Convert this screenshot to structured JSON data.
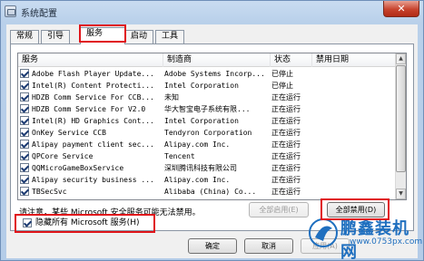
{
  "window": {
    "title": "系统配置",
    "close_glyph": "✕"
  },
  "tabs": [
    {
      "label": "常规"
    },
    {
      "label": "引导"
    },
    {
      "label": "服务"
    },
    {
      "label": "启动"
    },
    {
      "label": "工具"
    }
  ],
  "services": {
    "columns": [
      "服务",
      "制造商",
      "状态",
      "禁用日期"
    ],
    "rows": [
      {
        "name": "Adobe Flash Player Update...",
        "manufacturer": "Adobe Systems Incorp...",
        "status": "已停止",
        "checked": true
      },
      {
        "name": "Intel(R) Content Protecti...",
        "manufacturer": "Intel Corporation",
        "status": "已停止",
        "checked": true
      },
      {
        "name": "HDZB Comm Service For CCB...",
        "manufacturer": "未知",
        "status": "正在运行",
        "checked": true
      },
      {
        "name": "HDZB Comm Service For V2.0",
        "manufacturer": "华大智宝电子系统有限...",
        "status": "正在运行",
        "checked": true
      },
      {
        "name": "Intel(R) HD Graphics Cont...",
        "manufacturer": "Intel Corporation",
        "status": "正在运行",
        "checked": true
      },
      {
        "name": "OnKey Service CCB",
        "manufacturer": "Tendyron Corporation",
        "status": "正在运行",
        "checked": true
      },
      {
        "name": "Alipay payment client sec...",
        "manufacturer": "Alipay.com Inc.",
        "status": "正在运行",
        "checked": true
      },
      {
        "name": "QPCore Service",
        "manufacturer": "Tencent",
        "status": "正在运行",
        "checked": true
      },
      {
        "name": "QQMicroGameBoxService",
        "manufacturer": "深圳腾讯科技有限公司",
        "status": "正在运行",
        "checked": true
      },
      {
        "name": "Alipay security business ...",
        "manufacturer": "Alipay.com Inc.",
        "status": "正在运行",
        "checked": true
      },
      {
        "name": "TBSecSvc",
        "manufacturer": "Alibaba (China) Co...",
        "status": "正在运行",
        "checked": true
      }
    ]
  },
  "note": "请注意，某些 Microsoft 安全服务可能无法禁用。",
  "buttons": {
    "enable_all": "全部启用(E)",
    "disable_all": "全部禁用(D)",
    "ok": "确定",
    "cancel": "取消",
    "apply": "应用(A)"
  },
  "hide_microsoft": {
    "label": "隐藏所有 Microsoft 服务(H)",
    "checked": true
  },
  "watermark": {
    "title": "鹏鑫装机网",
    "url": "www.0753px.com"
  },
  "colors": {
    "highlight": "#e0141a",
    "watermark": "#1f6fbf"
  }
}
